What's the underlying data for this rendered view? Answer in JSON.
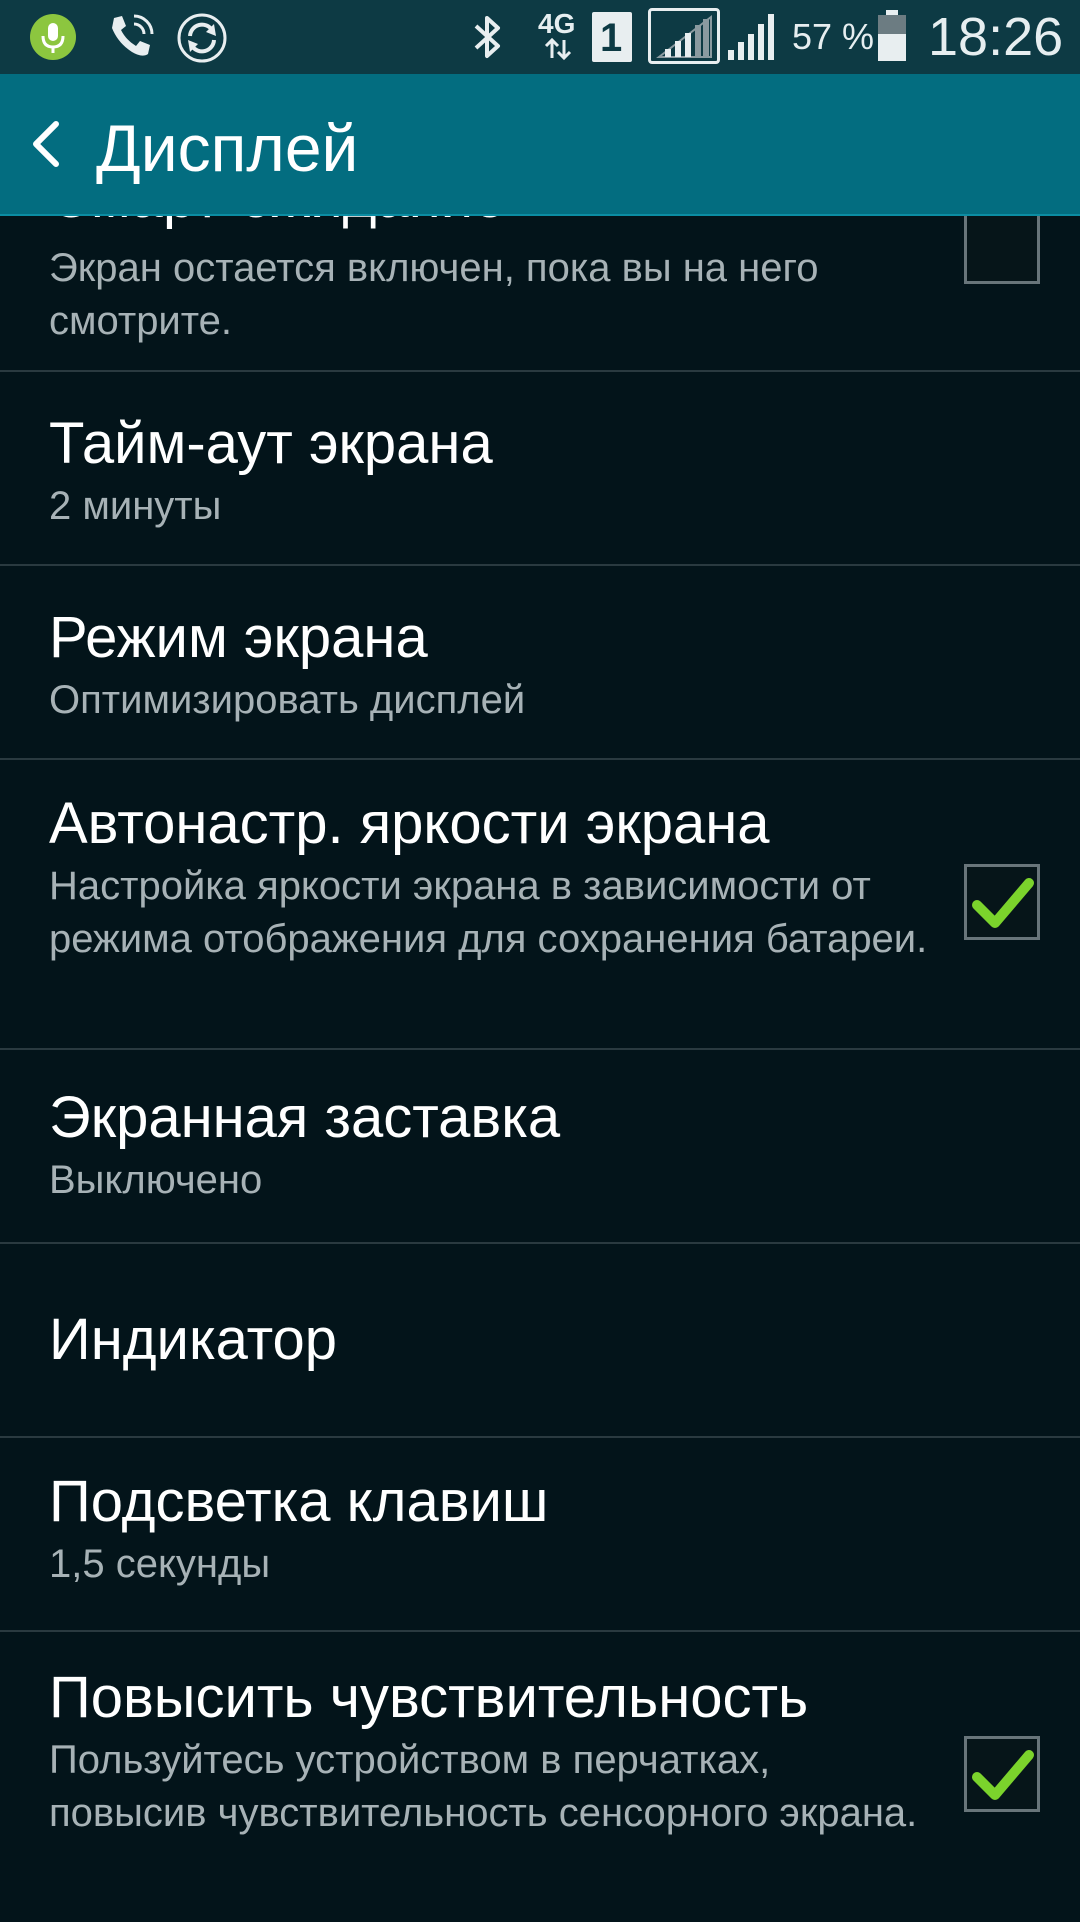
{
  "status_bar": {
    "icons": [
      "mic-icon",
      "phone-wifi-call-icon",
      "sync-icon",
      "bluetooth-icon",
      "network-4g-icon",
      "sim-1-icon",
      "signal-icon",
      "signal-icon",
      "battery-icon"
    ],
    "network": "4G",
    "sim": "1",
    "battery": "57 %",
    "time": "18:26"
  },
  "header": {
    "title": "Дисплей",
    "back_icon": "chevron-left-icon"
  },
  "settings": [
    {
      "title": "Смарт-ожидание",
      "subtitle": "Экран остается включен, пока вы на него смотрите.",
      "checkbox": false
    },
    {
      "title": "Тайм-аут экрана",
      "subtitle": "2 минуты"
    },
    {
      "title": "Режим экрана",
      "subtitle": "Оптимизировать дисплей"
    },
    {
      "title": "Автонастр. яркости экрана",
      "subtitle": "Настройка яркости экрана в зависимости от режима отображения для сохранения батареи.",
      "checkbox": true
    },
    {
      "title": "Экранная заставка",
      "subtitle": "Выключено"
    },
    {
      "title": "Индикатор"
    },
    {
      "title": "Подсветка клавиш",
      "subtitle": "1,5 секунды"
    },
    {
      "title": "Повысить чувствительность",
      "subtitle": "Пользуйтесь устройством в перчатках, повысив чувствительность сенсорного экрана.",
      "checkbox": true
    }
  ],
  "colors": {
    "app_bar": "#036d80",
    "status_bar": "#0d3a44",
    "background": "#03141a",
    "check_mark": "#7bd32c"
  }
}
